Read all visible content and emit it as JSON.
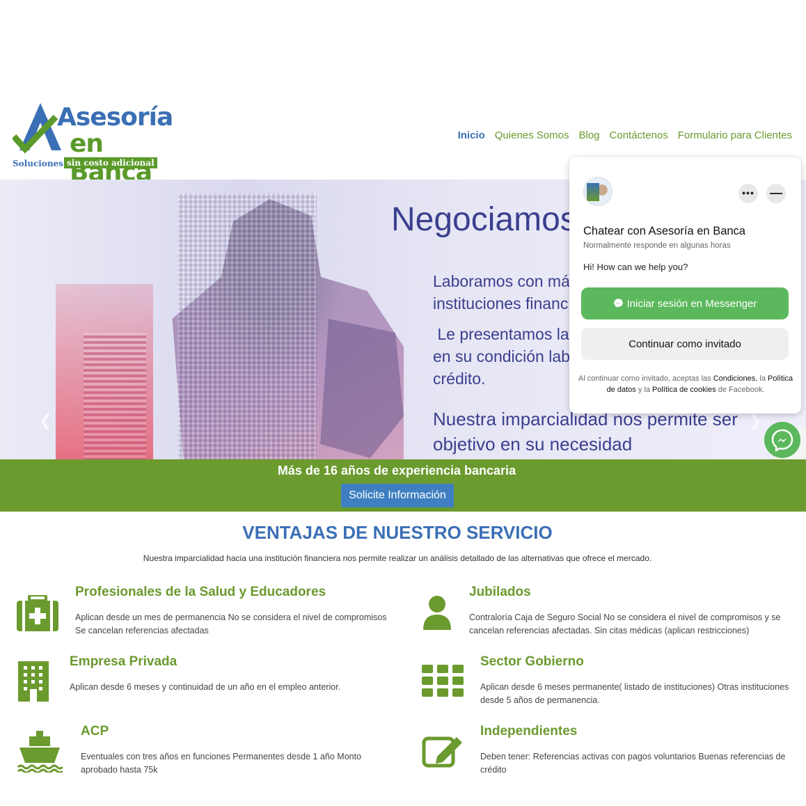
{
  "header": {
    "logo": {
      "line1": "Asesoría",
      "line2": "en Banca",
      "tag1": "Soluciones",
      "tag2": "sin costo adicional"
    },
    "nav": [
      {
        "label": "Inicio",
        "active": true
      },
      {
        "label": "Quienes Somos",
        "active": false
      },
      {
        "label": "Blog",
        "active": false
      },
      {
        "label": "Contáctenos",
        "active": false
      },
      {
        "label": "Formulario para Clientes",
        "active": false
      }
    ]
  },
  "hero": {
    "title": "Negociamos",
    "p1": "Laboramos con más\ninstituciones financ",
    "p2": " Le presentamos la\nen su condición lab\ncrédito.",
    "p3": "Nuestra imparcialidad nos permite ser\nobjetivo en su necesidad",
    "prev_icon": "chevron-left-icon",
    "next_icon": "chevron-right-icon"
  },
  "band": {
    "title": "Más de 16 años de experiencia bancaria",
    "button": "Solicite Información",
    "color": "#6b9a2e"
  },
  "section": {
    "title": "VENTAJAS DE NUESTRO SERVICIO",
    "subtitle": "Nuestra imparcialidad hacia una institución financiera nos permite realizar un análisis detallado de las alternativas que ofrece el mercado.",
    "items": [
      {
        "icon": "medical-kit-icon",
        "title": "Profesionales de la Salud y Educadores",
        "text": "Aplican desde un mes de permanencia No se considera el nivel de compromisos Se cancelan referencias afectadas"
      },
      {
        "icon": "user-icon",
        "title": "Jubilados",
        "text": "Contraloría Caja de Seguro Social No se considera el nivel de compromisos y se cancelan referencias afectadas. Sin citas médicas (aplican restricciones)"
      },
      {
        "icon": "building-icon",
        "title": "Empresa Privada",
        "text": "Aplican desde 6 meses y continuidad de un año en el empleo anterior."
      },
      {
        "icon": "grid-icon",
        "title": "Sector Gobierno",
        "text": "Aplican desde 6 meses permanente( listado de instituciones) Otras instituciones desde 5 años de permanencia."
      },
      {
        "icon": "ship-icon",
        "title": "ACP",
        "text": "Eventuales con tres años en funciones Permanentes desde 1 año Monto aprobado hasta 75k"
      },
      {
        "icon": "edit-icon",
        "title": "Independientes",
        "text": "Deben tener: Referencias activas con pagos voluntarios Buenas referencias de crédito"
      }
    ]
  },
  "messenger": {
    "name": "Chatear con Asesoría en Banca",
    "response": "Normalmente responde en algunas horas",
    "greeting": "Hi! How can we help you?",
    "login_button": "Iniciar sesión en Messenger",
    "guest_button": "Continuar como invitado",
    "legal": {
      "t1": "Al continuar como invitado, aceptas las ",
      "l1": "Condiciones",
      "t2": ", la ",
      "l2": "Política de datos",
      "t3": " y la ",
      "l3": "Política de cookies",
      "t4": " de Facebook."
    },
    "more_label": "•••",
    "min_label": "—",
    "accent": "#5cb85c"
  }
}
